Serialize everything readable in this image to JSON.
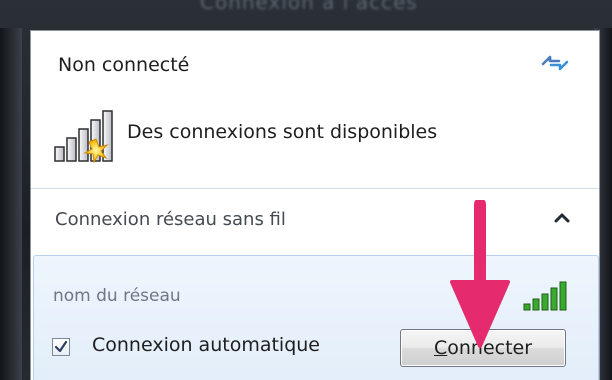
{
  "window": {
    "title_fragment": "Connexion à l'accès"
  },
  "status": {
    "title": "Non connecté",
    "refresh_icon": "refresh-icon",
    "availability_icon": "wireless-unavailable-icon",
    "availability_text": "Des connexions sont disponibles"
  },
  "wireless_section": {
    "title": "Connexion réseau sans fil",
    "collapse_icon": "chevron-up-icon",
    "networks": [
      {
        "name": "nom du réseau",
        "signal_icon": "signal-strength-icon",
        "signal_bars": 5,
        "auto_connect_label": "Connexion automatique",
        "auto_connect_checked": true,
        "connect_button": {
          "before": "",
          "mnemonic": "C",
          "after": "onnecter"
        }
      }
    ]
  },
  "colors": {
    "arrow": "#e62a6e",
    "selected_item_bg": "#e8f1fb",
    "selected_item_border": "#b7d0ee",
    "signal_green": "#3aa92f"
  }
}
